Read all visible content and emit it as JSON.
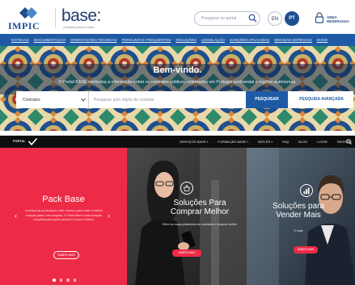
{
  "top": {
    "impic_logo": "IMPIC",
    "base_logo": "base",
    "base_logo_colon": ":",
    "base_subtitle": "contratos públicos online",
    "search_placeholder": "Pesquisar no portal",
    "lang_en": "EN",
    "lang_pt": "PT",
    "login_label": "ÁREA RESERVADA",
    "nav": [
      "NOTÍCIAS",
      "DOCUMENTAÇÃO",
      "ORIENTAÇÕES TÉCNICAS",
      "PERGUNTAS FREQUENTES",
      "SOLUÇÕES",
      "LEGISLAÇÃO",
      "SANÇÕES APLICADAS",
      "MEDIDAS ESPECIAIS",
      "DOCE"
    ],
    "welcome": "Bem-vindo.",
    "intro": "O Portal BASE centraliza a informação sobre os contratos públicos celebrados em Portugal continental e regiões autónomas.",
    "search_select": "Contratos",
    "search_input_placeholder": "Pesquisar pelo objeto do contrato",
    "search_button": "PESQUISAR",
    "advanced_button": "PESQUISA AVANÇADA",
    "colors": {
      "nav_blue": "#1f5aa6",
      "brand_dark": "#1d3c6e"
    }
  },
  "bottom": {
    "logo_text": "PORTAL",
    "nav": [
      "SERVIÇOS BASE",
      "FORMAÇÃO BASE",
      "NÓS ÉS",
      "FAQ",
      "BLOG",
      "LOGIN",
      "REGISTO"
    ],
    "pack": {
      "title": "Pack Base",
      "desc": "Conheça já os serviços e fale conosco para obter a melhor solução para o seu negócio. O Pack Base é uma solução completa para quem procura o futuro Dólares.",
      "button": "SABER MAIS"
    },
    "comprar": {
      "title": "Soluções Para Comprar Melhor",
      "sub": "Entre na nossa plataforma de contratos e comprar melhor",
      "button": "SABER MAIS"
    },
    "vender": {
      "title": "Soluções para Vender Mais",
      "sub": "E mais",
      "button": "SABER MAIS"
    },
    "colors": {
      "accent_red": "#ee2b47"
    }
  }
}
